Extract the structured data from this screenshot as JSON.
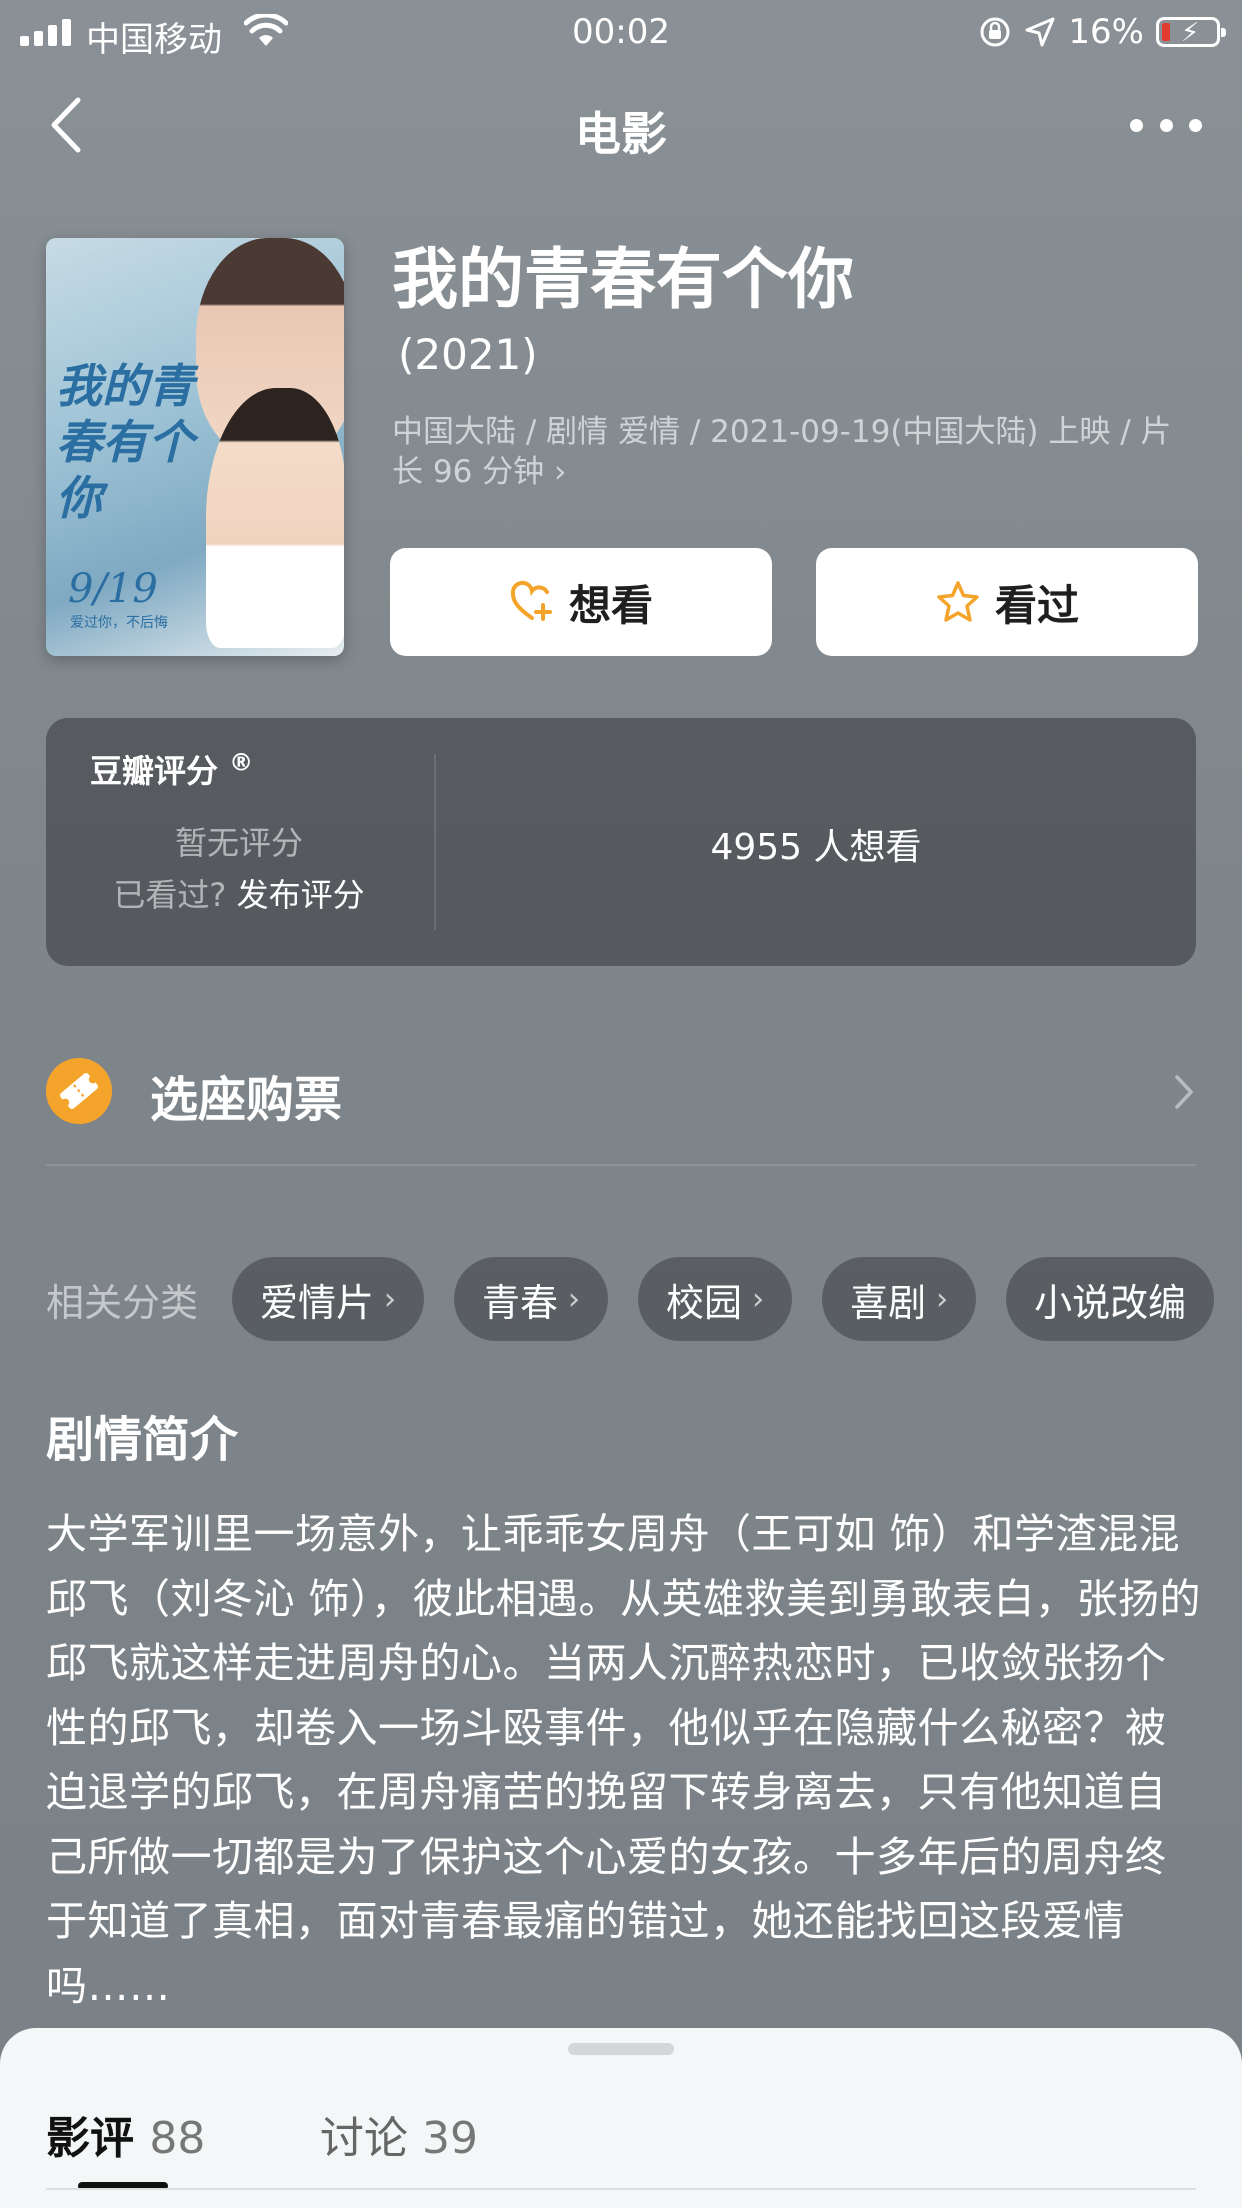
{
  "status_bar": {
    "carrier": "中国移动",
    "time": "00:02",
    "battery": "16%"
  },
  "nav": {
    "title": "电影"
  },
  "movie": {
    "title": "我的青春有个你",
    "year": "(2021)",
    "meta": "中国大陆 / 剧情 爱情 / 2021-09-19(中国大陆) 上映 / 片长 96 分钟 ›",
    "poster": {
      "title": "我的青春有个你",
      "date": "9/19",
      "slogan": "爱过你，不后悔"
    }
  },
  "actions": {
    "want": "想看",
    "seen": "看过"
  },
  "rating": {
    "label": "豆瓣评分",
    "trademark": "®",
    "no_rating": "暂无评分",
    "seen_question": "已看过?",
    "rate_link": "发布评分",
    "want_count": "4955 人想看"
  },
  "ticket": {
    "label": "选座购票"
  },
  "tags": {
    "label": "相关分类",
    "items": [
      "爱情片",
      "青春",
      "校园",
      "喜剧",
      "小说改编"
    ]
  },
  "synopsis": {
    "heading": "剧情简介",
    "text": "大学军训里一场意外，让乖乖女周舟（王可如 饰）和学渣混混邱飞（刘冬沁 饰），彼此相遇。从英雄救美到勇敢表白，张扬的邱飞就这样走进周舟的心。当两人沉醉热恋时，已收敛张扬个性的邱飞，却卷入一场斗殴事件，他似乎在隐藏什么秘密？被迫退学的邱飞，在周舟痛苦的挽留下转身离去，只有他知道自己所做一切都是为了保护这个心爱的女孩。十多年后的周舟终于知道了真相，面对青春最痛的错过，她还能找回这段爱情吗……"
  },
  "bottom_tabs": {
    "reviews_label": "影评",
    "reviews_count": "88",
    "discussion_label": "讨论",
    "discussion_count": "39"
  },
  "colors": {
    "accent": "#f4a42a",
    "background": "#858c91"
  }
}
